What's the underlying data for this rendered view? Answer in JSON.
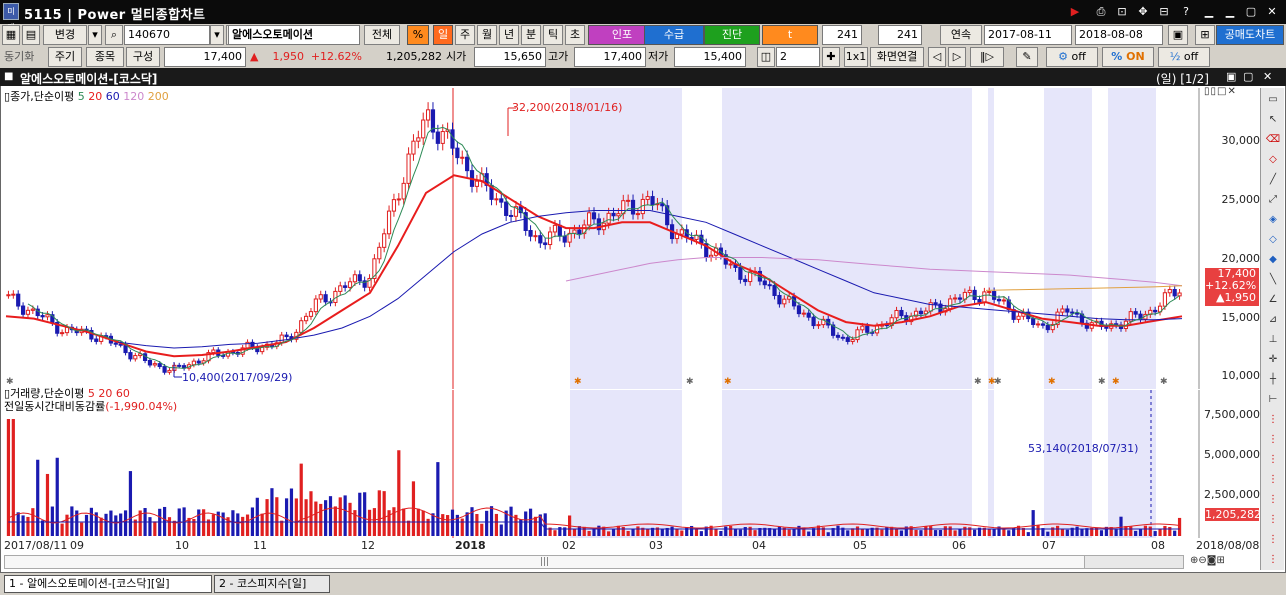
{
  "window": {
    "title": "5115 | Power 멀티종합차트",
    "icon": "미래"
  },
  "toolbar1": {
    "change_label": "변경",
    "code": "140670",
    "stock_name": "알에스오토메이션",
    "all_label": "전체",
    "percent_label": "%",
    "period_day": "일",
    "period_week": "주",
    "period_month": "월",
    "period_year": "년",
    "period_minute": "분",
    "period_tick": "틱",
    "period_second": "초",
    "infopo": "인포",
    "supply": "수급",
    "diagnosis": "진단",
    "t_label": "t",
    "count1": "241",
    "count2": "241",
    "continuous": "연속",
    "date_from": "2017-08-11",
    "date_to": "2018-08-08",
    "short_chart": "공매도차트"
  },
  "toolbar2": {
    "sync_label": "동기화",
    "period": "주기",
    "item": "종목",
    "compose": "구성",
    "price": "17,400",
    "change": "1,950",
    "change_pct": "+12.62%",
    "volume": "1,205,282",
    "open_label": "시가",
    "open": "15,650",
    "high_label": "고가",
    "high": "17,400",
    "low_label": "저가",
    "low": "15,400",
    "split_count": "2",
    "layout_label": "1x1",
    "screen_link": "화면연결",
    "off1": "off",
    "on": "ON",
    "off2": "off"
  },
  "chart_window": {
    "title": "알에스오토메이션-[코스닥]",
    "page": "(일) [1/2]"
  },
  "price_pane": {
    "legend": "종가,단순이평",
    "ma": [
      {
        "label": "5",
        "color": "#2e8b57"
      },
      {
        "label": "20",
        "color": "#e81d1d"
      },
      {
        "label": "60",
        "color": "#1a1ab0"
      },
      {
        "label": "120",
        "color": "#cc88cc"
      },
      {
        "label": "200",
        "color": "#e0a040"
      }
    ],
    "annot_high": "32,200(2018/01/16)",
    "annot_low": "10,400(2017/09/29)",
    "y_ticks": [
      "30,000",
      "25,000",
      "20,000",
      "15,000",
      "10,000"
    ],
    "last_price": "17,400",
    "last_pct": "+12.62%",
    "last_change": "▲1,950"
  },
  "volume_pane": {
    "legend1": "거래량,단순이평",
    "legend1_vals": "5 20 60",
    "legend2": "전일동시간대비동감률",
    "legend2_val": "(-1,990.04%)",
    "annot_max": "53,140(2018/07/31)",
    "y_ticks": [
      "7,500,000",
      "5,000,000",
      "2,500,000"
    ],
    "last_volume": "1,205,282"
  },
  "x_axis": [
    "2017/08/11",
    "09",
    "10",
    "11",
    "12",
    "2018",
    "02",
    "03",
    "04",
    "05",
    "06",
    "07",
    "08",
    "2018/08/08"
  ],
  "tabs": [
    "1 - 알에스오토메이션-[코스닥][일]",
    "2 - 코스피지수[일]"
  ],
  "chart_data": {
    "type": "candlestick",
    "title": "알에스오토메이션-[코스닥]",
    "x_range": [
      "2017-08-11",
      "2018-08-08"
    ],
    "ylim": [
      10000,
      32500
    ],
    "series": [
      {
        "name": "종가",
        "values": [
          16500,
          15200,
          13800,
          13500,
          12400,
          11000,
          10400,
          11500,
          12000,
          12400,
          13000,
          16000,
          17500,
          18500,
          26000,
          32200,
          29000,
          26000,
          24000,
          21500,
          22000,
          23000,
          24000,
          25000,
          22000,
          21000,
          19000,
          18000,
          16000,
          14500,
          13000,
          14000,
          15000,
          15500,
          16500,
          17000,
          15500,
          14000,
          15500,
          14000,
          14500,
          15500,
          17400
        ]
      },
      {
        "name": "20",
        "values": [
          15000,
          14800,
          14200,
          13600,
          12800,
          12000,
          11600,
          11700,
          12000,
          12400,
          12800,
          14000,
          15500,
          17000,
          21000,
          25500,
          27000,
          26500,
          25000,
          23500,
          22500,
          22500,
          23000,
          23000,
          22000,
          21000,
          19500,
          18500,
          17000,
          15500,
          14500,
          14200,
          14500,
          15000,
          15800,
          16200,
          15500,
          14800,
          14500,
          14200,
          14200,
          14600,
          15000
        ]
      },
      {
        "name": "60",
        "values": [
          null,
          null,
          null,
          null,
          12800,
          12500,
          12300,
          12400,
          12600,
          12700,
          13000,
          13400,
          14000,
          15000,
          16500,
          18500,
          20500,
          22000,
          23000,
          23500,
          23800,
          24000,
          24000,
          24000,
          23500,
          23000,
          22000,
          21000,
          20000,
          19000,
          18000,
          17000,
          16500,
          16000,
          15800,
          15600,
          15400,
          15200,
          15000,
          14800,
          14700,
          14700,
          14800
        ]
      },
      {
        "name": "120",
        "values": [
          null,
          null,
          null,
          null,
          null,
          null,
          null,
          null,
          null,
          null,
          null,
          null,
          null,
          null,
          null,
          null,
          null,
          null,
          null,
          null,
          18000,
          18500,
          19000,
          19500,
          19800,
          20000,
          20000,
          20000,
          19900,
          19800,
          19600,
          19400,
          19200,
          19000,
          18900,
          18800,
          18700,
          18600,
          18500,
          18300,
          18100,
          17900,
          17600
        ]
      },
      {
        "name": "200",
        "values": [
          null,
          null,
          null,
          null,
          null,
          null,
          null,
          null,
          null,
          null,
          null,
          null,
          null,
          null,
          null,
          null,
          null,
          null,
          null,
          null,
          null,
          null,
          null,
          null,
          null,
          null,
          null,
          null,
          null,
          null,
          null,
          null,
          null,
          null,
          null,
          17200,
          17250,
          17300,
          17350,
          17400,
          17450,
          17500,
          17600
        ]
      }
    ],
    "volume_max": 53140,
    "volume_ylim": [
      0,
      8500000
    ]
  }
}
